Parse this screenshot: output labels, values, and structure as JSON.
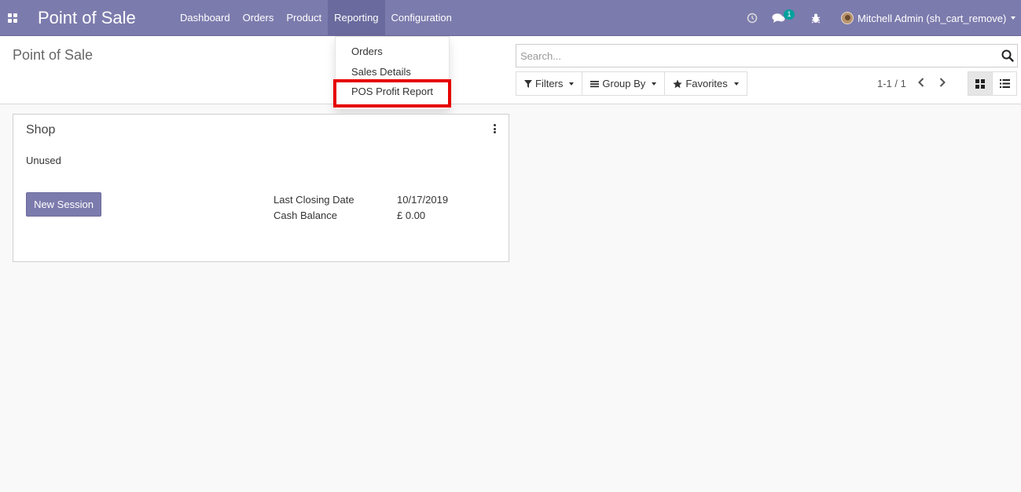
{
  "navbar": {
    "brand": "Point of Sale",
    "menu": [
      "Dashboard",
      "Orders",
      "Product",
      "Reporting",
      "Configuration"
    ],
    "active_menu": "Reporting",
    "chat_badge": "1",
    "user": "Mitchell Admin (sh_cart_remove)",
    "colors": {
      "bar": "#7c7bad",
      "active": "#6a6a9e",
      "badge": "#00a09d"
    }
  },
  "control": {
    "title": "Point of Sale",
    "search_placeholder": "Search...",
    "filters_label": "Filters",
    "groupby_label": "Group By",
    "favorites_label": "Favorites",
    "pager": "1-1 / 1"
  },
  "reporting_menu": {
    "items": [
      "Orders",
      "Sales Details",
      "POS Profit Report"
    ],
    "highlighted": "POS Profit Report",
    "highlight_color": "#e60000"
  },
  "card": {
    "title": "Shop",
    "status": "Unused",
    "button": "New Session",
    "last_closing_label": "Last Closing Date",
    "last_closing_value": "10/17/2019",
    "cash_balance_label": "Cash Balance",
    "cash_balance_value": "£ 0.00"
  }
}
